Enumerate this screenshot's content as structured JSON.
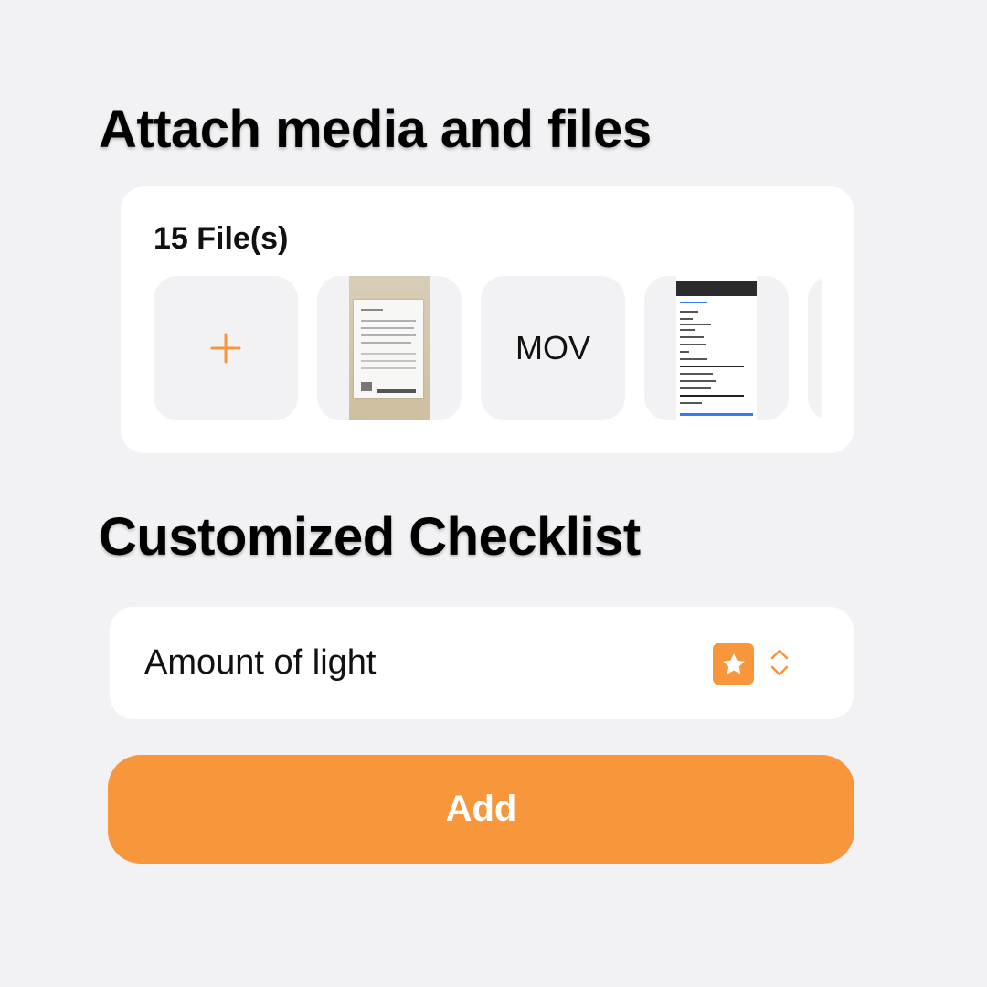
{
  "attach": {
    "title": "Attach media and files",
    "file_count": "15 File(s)",
    "thumbnails": [
      {
        "kind": "add",
        "icon": "plus-icon"
      },
      {
        "kind": "image",
        "description_icon": "document-photo"
      },
      {
        "kind": "video",
        "label": "MOV"
      },
      {
        "kind": "image",
        "description_icon": "screenshot"
      },
      {
        "kind": "partial"
      }
    ]
  },
  "checklist": {
    "title": "Customized Checklist",
    "item_label": "Amount of light",
    "item_icon": "star-icon",
    "selector_icon": "chevron-up-down-icon"
  },
  "actions": {
    "add_label": "Add"
  },
  "colors": {
    "accent": "#f8963b",
    "background": "#f2f2f4",
    "card": "#ffffff"
  }
}
